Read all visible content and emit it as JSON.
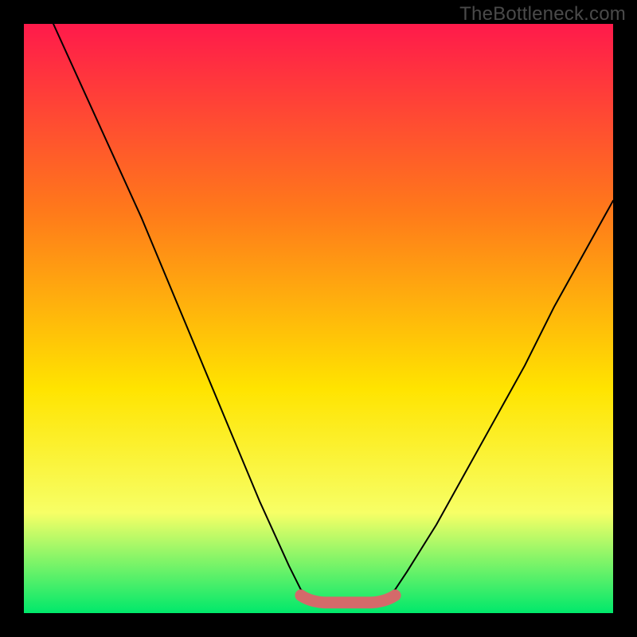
{
  "watermark": "TheBottleneck.com",
  "colors": {
    "frame": "#000000",
    "gradient_top": "#ff1a4b",
    "gradient_mid1": "#ff7a1a",
    "gradient_mid2": "#ffe400",
    "gradient_lower": "#f7ff66",
    "gradient_bottom": "#00e86b",
    "curve": "#000000",
    "highlight": "#d46a6a"
  },
  "chart_data": {
    "type": "line",
    "title": "",
    "xlabel": "",
    "ylabel": "",
    "xlim": [
      0,
      100
    ],
    "ylim": [
      0,
      100
    ],
    "note": "Bottleneck-style curve. y≈100 means worst (top/red), y≈0 means best (bottom/green). Values estimated from pixels.",
    "series": [
      {
        "name": "curve",
        "x": [
          5,
          10,
          15,
          20,
          25,
          30,
          35,
          40,
          45,
          47,
          50,
          53,
          55,
          57,
          60,
          63,
          65,
          70,
          75,
          80,
          85,
          90,
          95,
          100
        ],
        "y": [
          100,
          89,
          78,
          67,
          55,
          43,
          31,
          19,
          8,
          4,
          1.8,
          1.3,
          1.2,
          1.3,
          1.8,
          4,
          7,
          15,
          24,
          33,
          42,
          52,
          61,
          70
        ]
      }
    ],
    "highlight_region": {
      "x_start": 47,
      "x_end": 63,
      "y_approx": 2.2,
      "thickness_pct": 2.0,
      "note": "Short rounded segment drawn in muted red near the minimum."
    }
  }
}
